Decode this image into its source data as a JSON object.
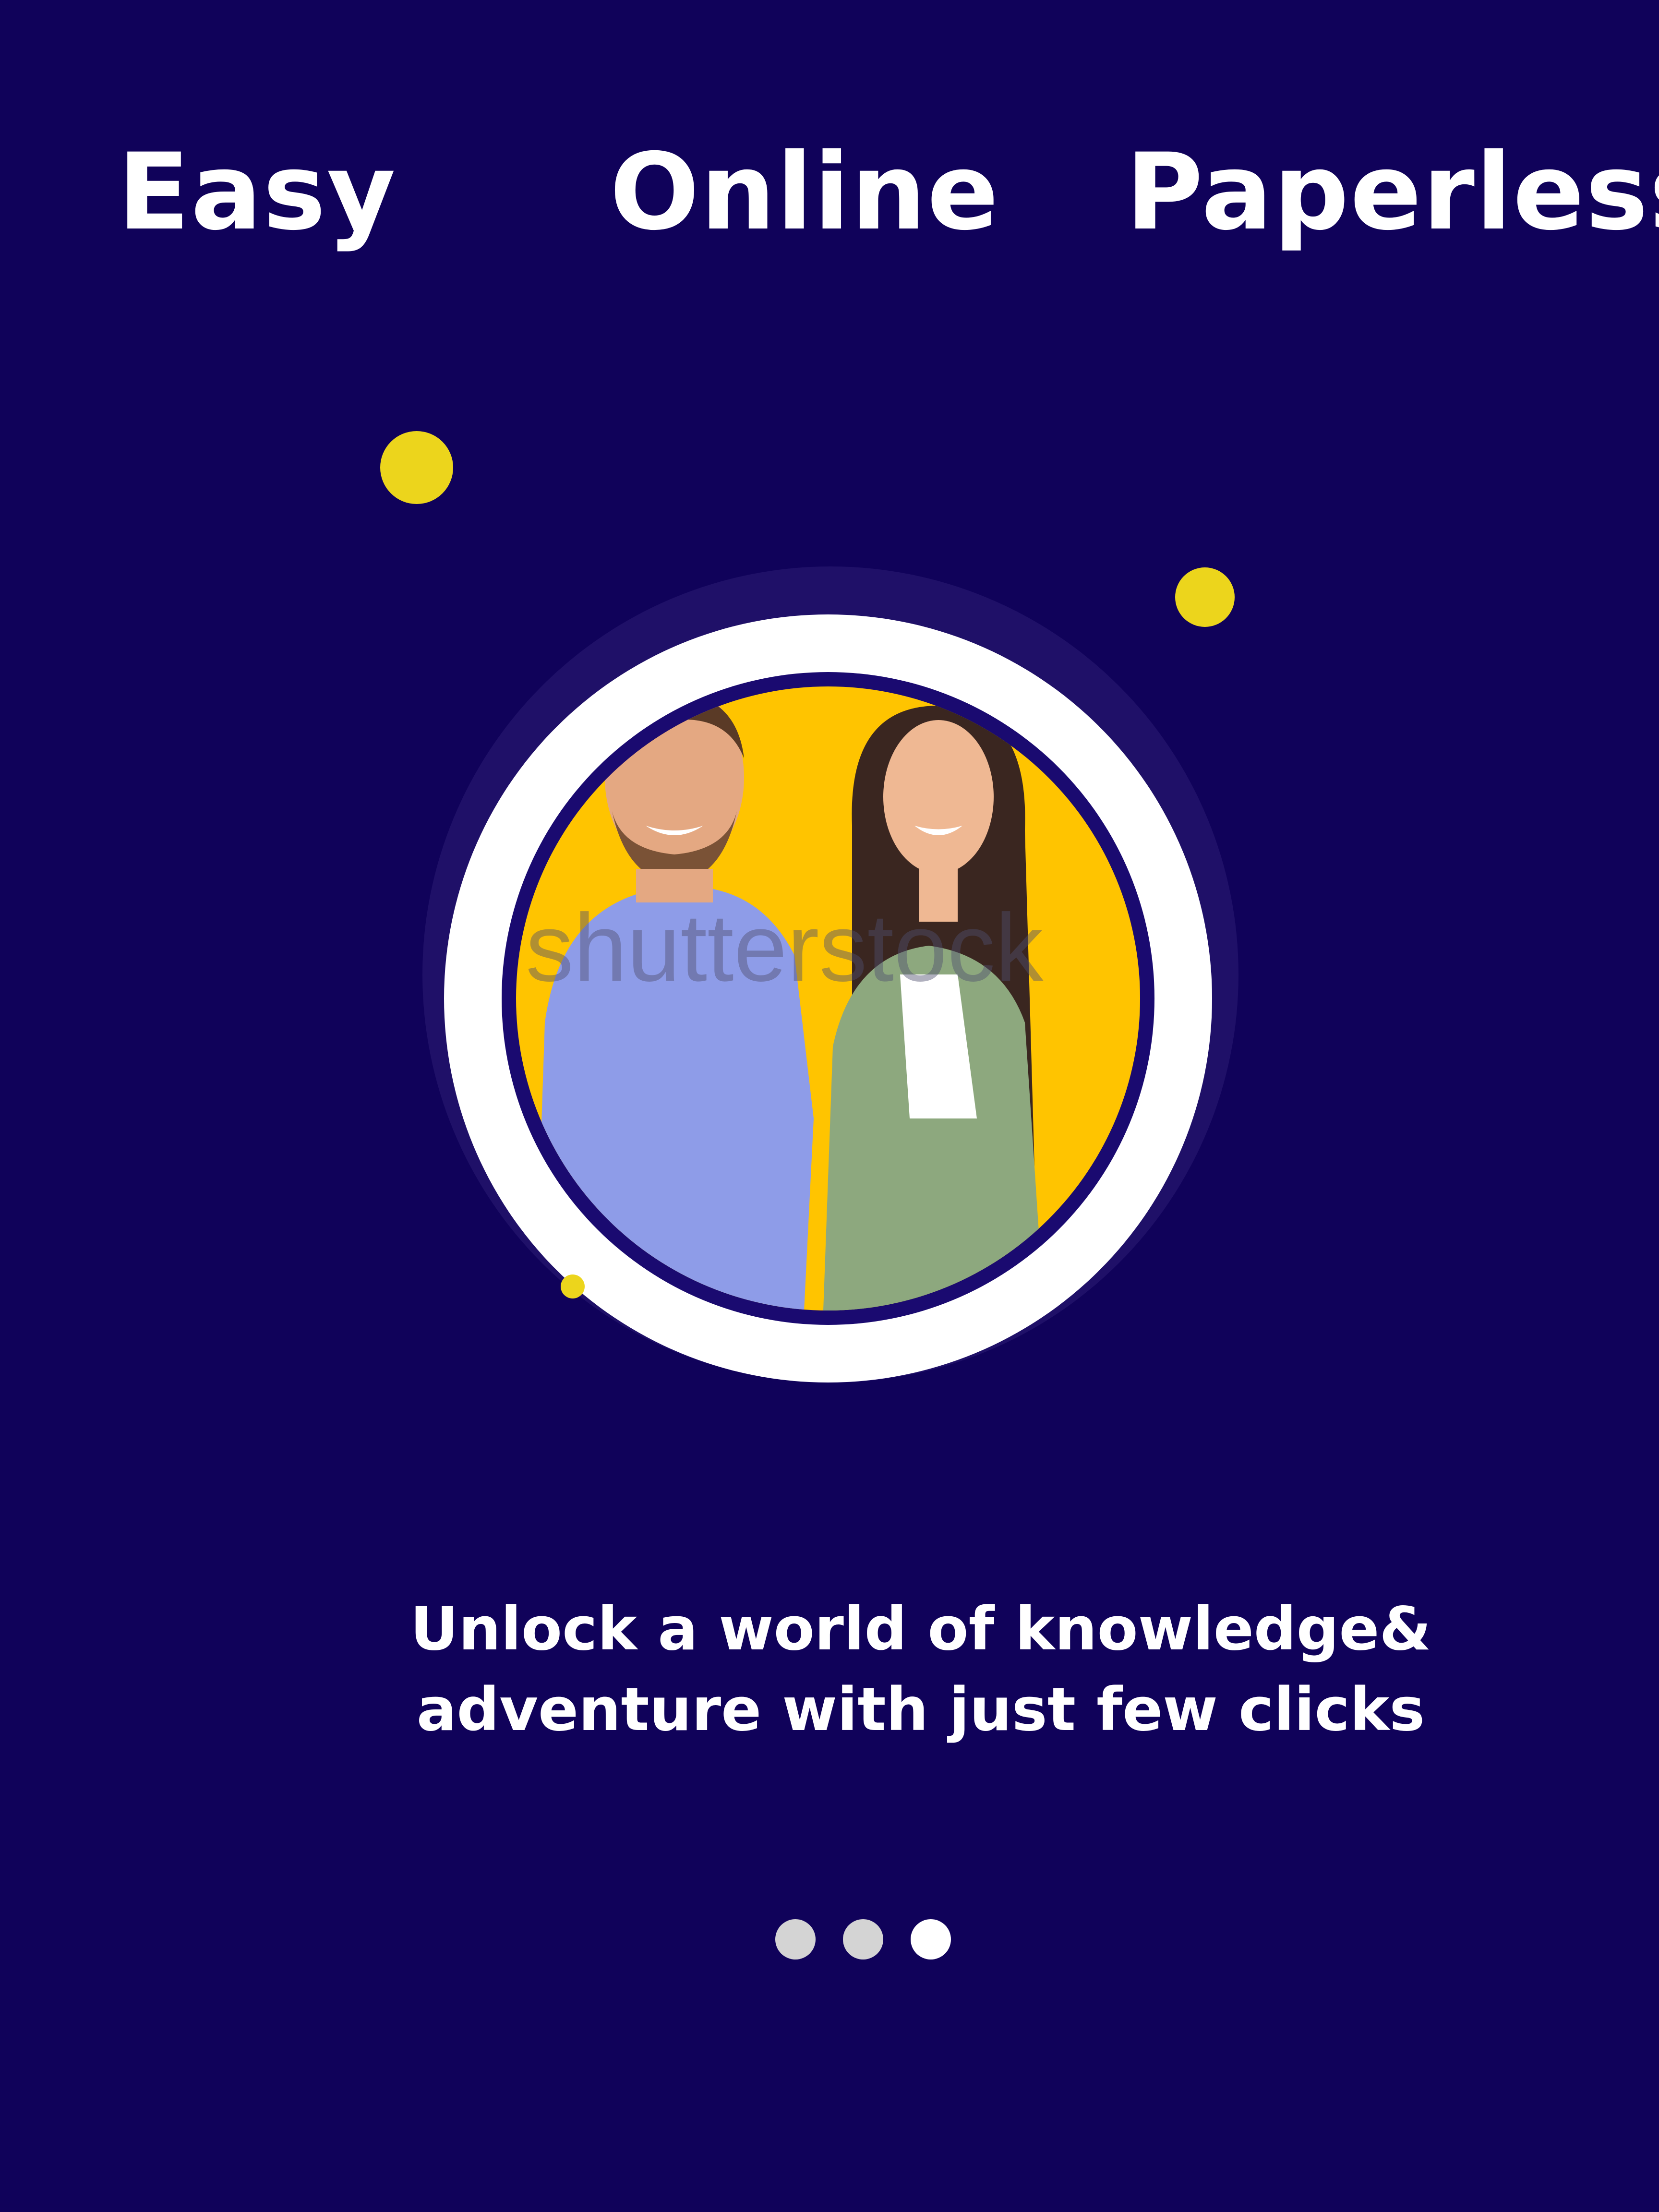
{
  "header": {
    "words": [
      "Easy",
      "Online",
      "Paperless"
    ]
  },
  "hero": {
    "watermark": "shutterstock"
  },
  "caption": {
    "line1": "Unlock a world of knowledge&",
    "line2": "adventure with just few clicks"
  },
  "pager": {
    "total_pages": 3,
    "active_page": 3
  },
  "colors": {
    "background": "#10025a",
    "accent_yellow": "#ecd51c",
    "photo_backdrop": "#ffc400",
    "ring": "#ffffff",
    "pager_inactive": "#d4d4d4",
    "pager_active": "#ffffff",
    "person1_shirt": "#8e9ce8",
    "person2_cardigan": "#8da87e"
  }
}
